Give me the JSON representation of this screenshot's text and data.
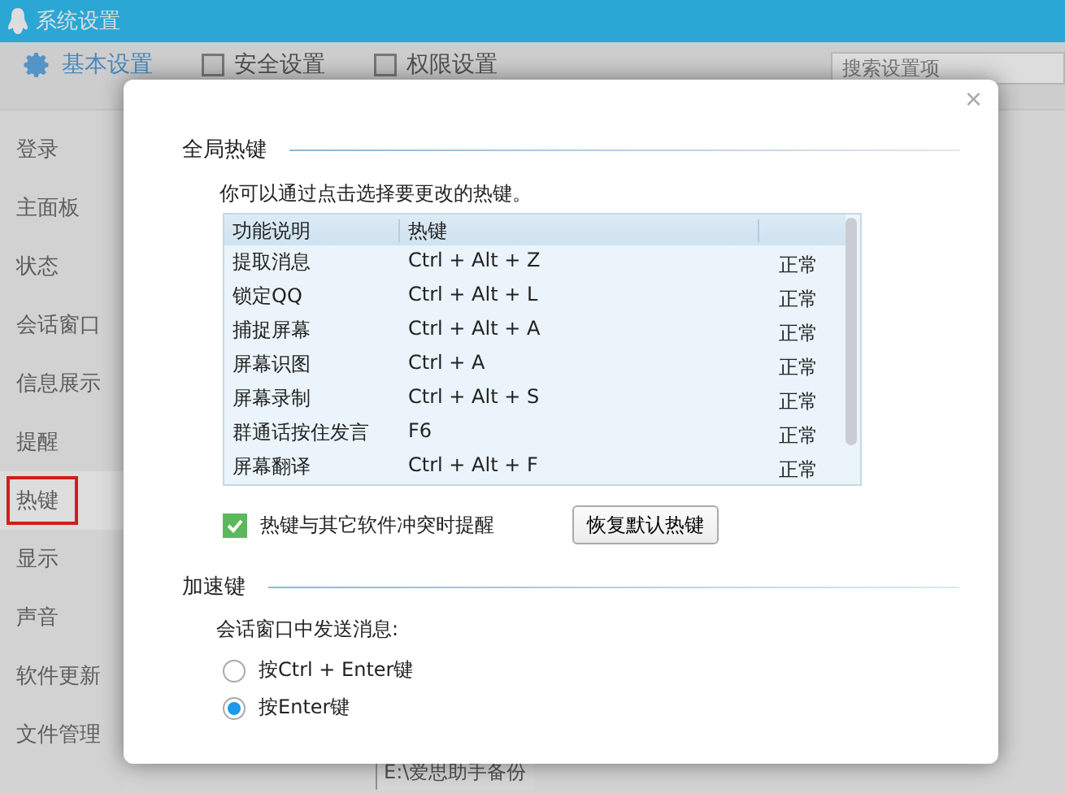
{
  "window": {
    "title": "系统设置"
  },
  "tabs": [
    {
      "label": "基本设置",
      "selected": true
    },
    {
      "label": "安全设置",
      "selected": false
    },
    {
      "label": "权限设置",
      "selected": false
    }
  ],
  "search": {
    "placeholder": "搜索设置项"
  },
  "sidebar": {
    "items": [
      {
        "label": "登录",
        "selected": false
      },
      {
        "label": "主面板",
        "selected": false
      },
      {
        "label": "状态",
        "selected": false
      },
      {
        "label": "会话窗口",
        "selected": false
      },
      {
        "label": "信息展示",
        "selected": false
      },
      {
        "label": "提醒",
        "selected": false
      },
      {
        "label": "热键",
        "selected": true
      },
      {
        "label": "显示",
        "selected": false
      },
      {
        "label": "声音",
        "selected": false
      },
      {
        "label": "软件更新",
        "selected": false
      },
      {
        "label": "文件管理",
        "selected": false
      }
    ]
  },
  "background_path": "E:\\爱思助手备份",
  "dialog": {
    "close": "×",
    "global_section": {
      "title": "全局热键",
      "hint": "你可以通过点击选择要更改的热键。",
      "table": {
        "columns": [
          "功能说明",
          "热键"
        ],
        "rows": [
          {
            "name": "提取消息",
            "keys": "Ctrl + Alt + Z",
            "status": "正常"
          },
          {
            "name": "锁定QQ",
            "keys": "Ctrl + Alt + L",
            "status": "正常"
          },
          {
            "name": "捕捉屏幕",
            "keys": "Ctrl + Alt + A",
            "status": "正常"
          },
          {
            "name": "屏幕识图",
            "keys": "Ctrl + A",
            "status": "正常"
          },
          {
            "name": "屏幕录制",
            "keys": "Ctrl + Alt + S",
            "status": "正常"
          },
          {
            "name": "群通话按住发言",
            "keys": "F6",
            "status": "正常"
          },
          {
            "name": "屏幕翻译",
            "keys": "Ctrl + Alt + F",
            "status": "正常"
          }
        ]
      },
      "conflict_alert": {
        "label": "热键与其它软件冲突时提醒",
        "checked": true
      },
      "restore_button": "恢复默认热键"
    },
    "accel_section": {
      "title": "加速键",
      "prompt": "会话窗口中发送消息:",
      "options": [
        {
          "label": "按Ctrl + Enter键",
          "selected": false
        },
        {
          "label": "按Enter键",
          "selected": true
        }
      ]
    }
  }
}
